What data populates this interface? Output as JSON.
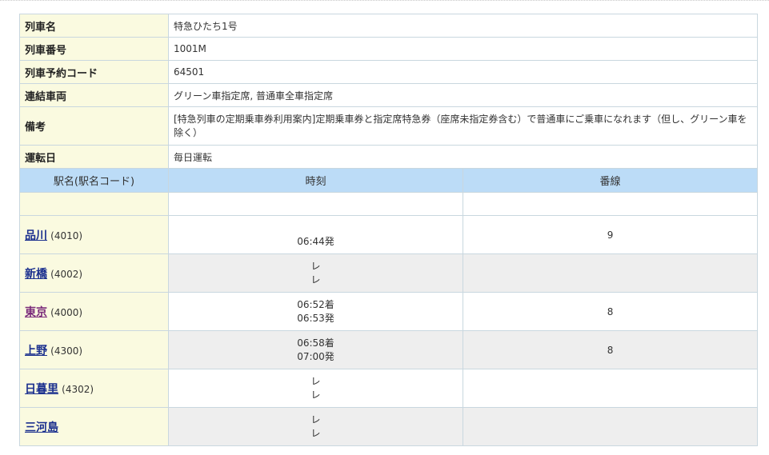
{
  "train_info": [
    {
      "label": "列車名",
      "value": "特急ひたち1号"
    },
    {
      "label": "列車番号",
      "value": "1001M"
    },
    {
      "label": "列車予約コード",
      "value": "64501"
    },
    {
      "label": "連結車両",
      "value": "グリーン車指定席, 普通車全車指定席"
    },
    {
      "label": "備考",
      "value": "[特急列車の定期乗車券利用案内]定期乗車券と指定席特急券（座席未指定券含む）で普通車にご乗車になれます（但し、グリーン車を除く）"
    },
    {
      "label": "運転日",
      "value": "毎日運転"
    }
  ],
  "timetable_header": {
    "station": "駅名(駅名コード)",
    "time": "時刻",
    "track": "番線"
  },
  "stations": [
    {
      "name": "品川",
      "code": "(4010)",
      "time1": "",
      "time2": "06:44発",
      "track": "9"
    },
    {
      "name": "新橋",
      "code": "(4002)",
      "time1": "レ",
      "time2": "レ",
      "track": ""
    },
    {
      "name": "東京",
      "code": "(4000)",
      "time1": "06:52着",
      "time2": "06:53発",
      "track": "8"
    },
    {
      "name": "上野",
      "code": "(4300)",
      "time1": "06:58着",
      "time2": "07:00発",
      "track": "8"
    },
    {
      "name": "日暮里",
      "code": "(4302)",
      "time1": "レ",
      "time2": "レ",
      "track": ""
    },
    {
      "name": "三河島",
      "code": "",
      "time1": "レ",
      "time2": "レ",
      "track": ""
    }
  ]
}
